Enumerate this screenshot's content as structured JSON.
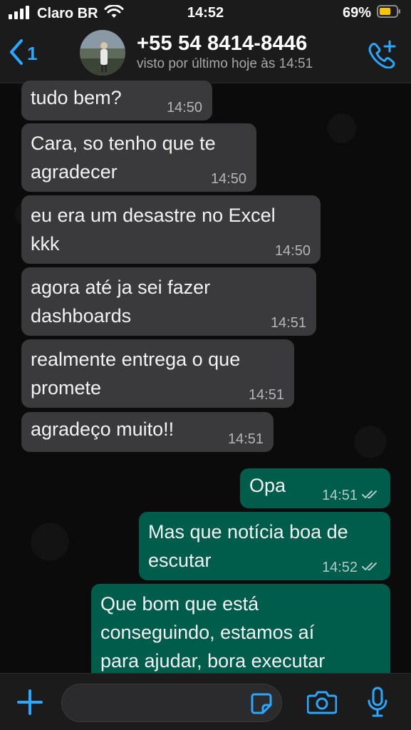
{
  "status_bar": {
    "carrier": "Claro BR",
    "time": "14:52",
    "battery": "69%",
    "battery_level": 0.69,
    "battery_color": "#f7c600",
    "signal_icon": "signal-bars-icon",
    "wifi_icon": "wifi-icon"
  },
  "header": {
    "back_count": "1",
    "contact_name": "+55 54 8414-8446",
    "contact_status": "visto por último hoje às 14:51",
    "accent_color": "#2aa7ff"
  },
  "messages": [
    {
      "direction": "in",
      "text": "tudo bem?",
      "time": "14:50"
    },
    {
      "direction": "in",
      "text": "Cara, so tenho que te\nagradecer",
      "time": "14:50"
    },
    {
      "direction": "in",
      "text": "eu era um desastre no Excel\nkkk",
      "time": "14:50"
    },
    {
      "direction": "in",
      "text": "agora até ja sei fazer\ndashboards",
      "time": "14:51"
    },
    {
      "direction": "in",
      "text": "realmente entrega o que\npromete",
      "time": "14:51"
    },
    {
      "direction": "in",
      "text": "agradeço muito!!",
      "time": "14:51"
    },
    {
      "direction": "out",
      "text": "Opa",
      "time": "14:51",
      "status": "read"
    },
    {
      "direction": "out",
      "text": "Mas que notícia boa de\nescutar",
      "time": "14:52",
      "status": "read"
    },
    {
      "direction": "out",
      "text": "Que bom que está\nconseguindo, estamos aí\npara ajudar, bora executar",
      "time": "",
      "status": ""
    }
  ],
  "composer": {
    "placeholder": "",
    "plus_icon": "plus-icon",
    "sticker_icon": "sticker-icon",
    "camera_icon": "camera-icon",
    "mic_icon": "microphone-icon"
  },
  "colors": {
    "incoming_bubble": "#3a3a3c",
    "outgoing_bubble": "#005c4b",
    "background": "#0b0b0b"
  }
}
